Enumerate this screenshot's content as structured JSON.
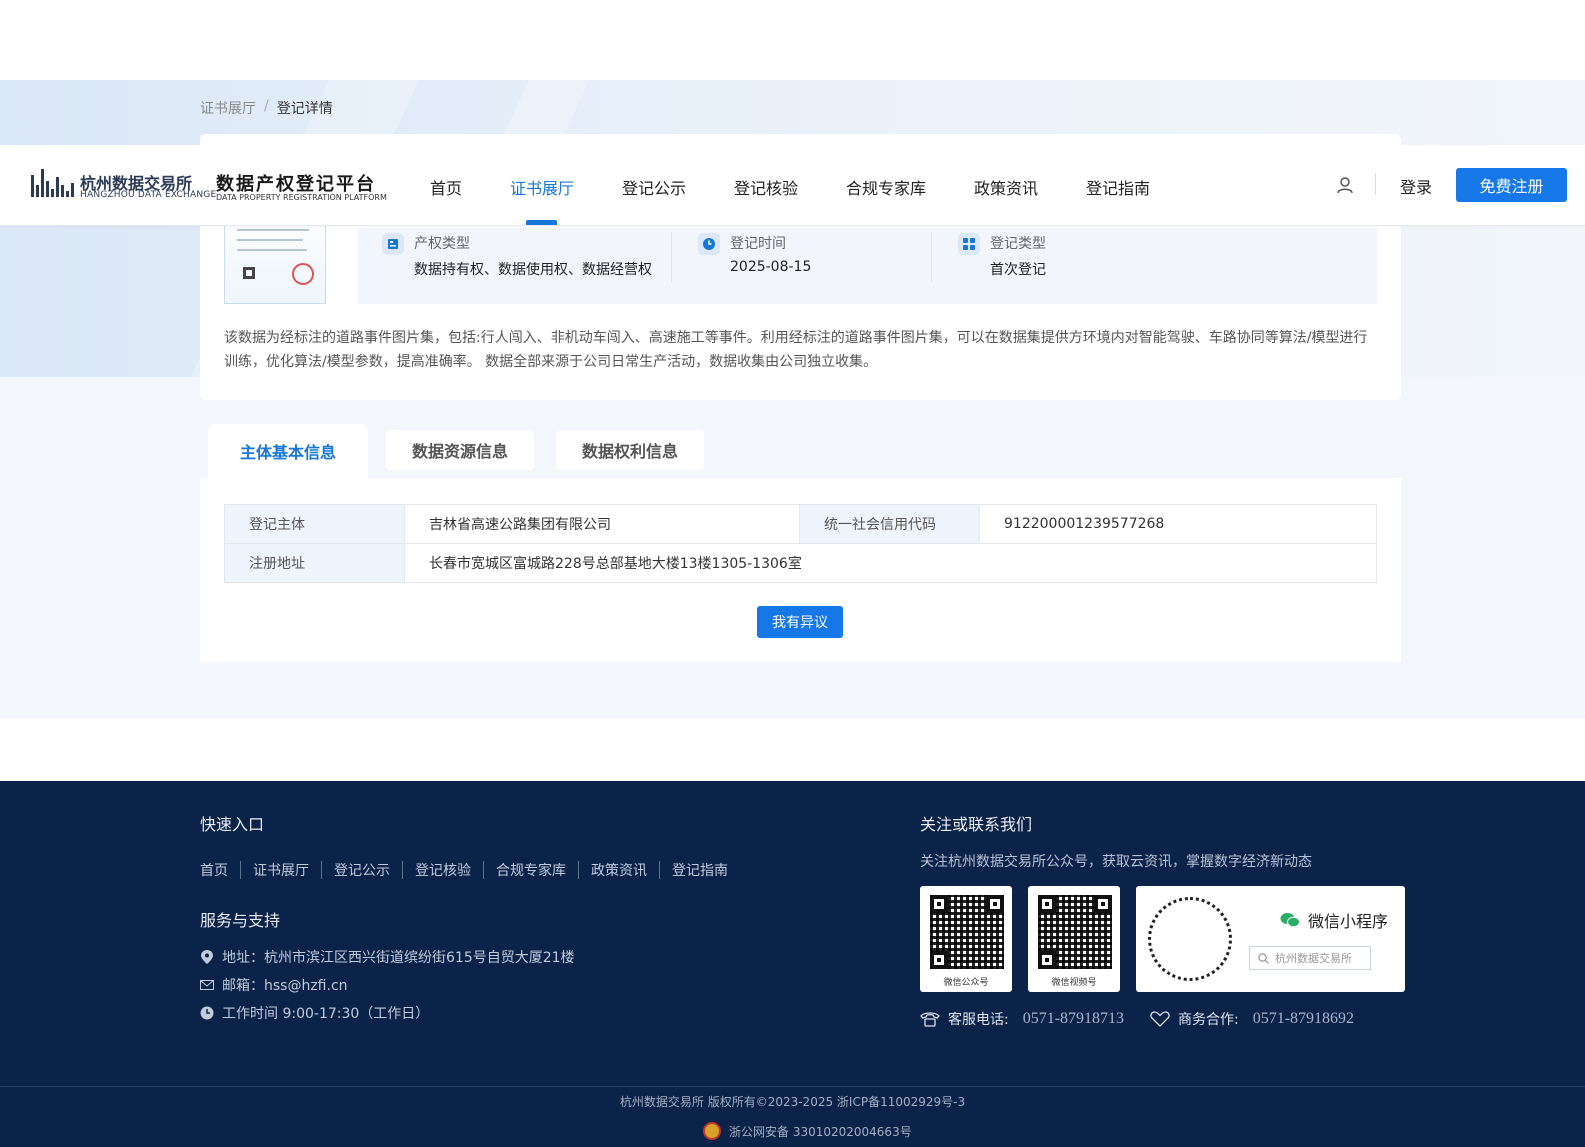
{
  "breadcrumb": {
    "parent": "证书展厅",
    "separator": "/",
    "current": "登记详情"
  },
  "header": {
    "logo_cn": "杭州数据交易所",
    "logo_en": "HANGZHOU DATA EXCHANGE",
    "platform_cn": "数据产权登记平台",
    "platform_en": "DATA PROPERTY REGISTRATION PLATFORM",
    "nav": [
      "首页",
      "证书展厅",
      "登记公示",
      "登记核验",
      "合规专家库",
      "政策资讯",
      "登记指南"
    ],
    "active_nav": "证书展厅",
    "login": "登录",
    "register": "免费注册"
  },
  "summary": {
    "rights_type_label": "产权类型",
    "rights_type_value": "数据持有权、数据使用权、数据经营权",
    "reg_time_label": "登记时间",
    "reg_time_value": "2025-08-15",
    "reg_type_label": "登记类型",
    "reg_type_value": "首次登记",
    "description": "该数据为经标注的道路事件图片集，包括:行人闯入、非机动车闯入、高速施工等事件。利用经标注的道路事件图片集，可以在数据集提供方环境内对智能驾驶、车路协同等算法/模型进行训练，优化算法/模型参数，提高准确率。 数据全部来源于公司日常生产活动，数据收集由公司独立收集。"
  },
  "tabs": [
    "主体基本信息",
    "数据资源信息",
    "数据权利信息"
  ],
  "active_tab": "主体基本信息",
  "entity": {
    "subject_label": "登记主体",
    "subject_value": "吉林省高速公路集团有限公司",
    "credit_label": "统一社会信用代码",
    "credit_value": "912200001239577268",
    "address_label": "注册地址",
    "address_value": "长春市宽城区富城路228号总部基地大楼13楼1305-1306室"
  },
  "dispute_button": "我有异议",
  "footer": {
    "quick_title": "快速入口",
    "quick_links": [
      "首页",
      "证书展厅",
      "登记公示",
      "登记核验",
      "合规专家库",
      "政策资讯",
      "登记指南"
    ],
    "service_title": "服务与支持",
    "address": "地址：杭州市滨江区西兴街道缤纷街615号自贸大厦21楼",
    "email": "邮箱：hss@hzfi.cn",
    "hours": "工作时间 9:00-17:30（工作日）",
    "follow_title": "关注或联系我们",
    "follow_sub": "关注杭州数据交易所公众号，获取云资讯，掌握数字经济新动态",
    "qr_wechat": "微信公众号",
    "qr_video": "微信视频号",
    "mini_title": "微信小程序",
    "mini_search": "杭州数据交易所",
    "service_phone_label": "客服电话:",
    "service_phone": "0571-87918713",
    "business_label": "商务合作:",
    "business_phone": "0571-87918692",
    "copyright": "杭州数据交易所 版权所有©2023-2025 浙ICP备11002929号-3",
    "beian": "浙公网安备 33010202004663号"
  },
  "colors": {
    "primary": "#1677e8",
    "footer_bg": "#0b2349",
    "label_bg": "#eef4fb"
  }
}
